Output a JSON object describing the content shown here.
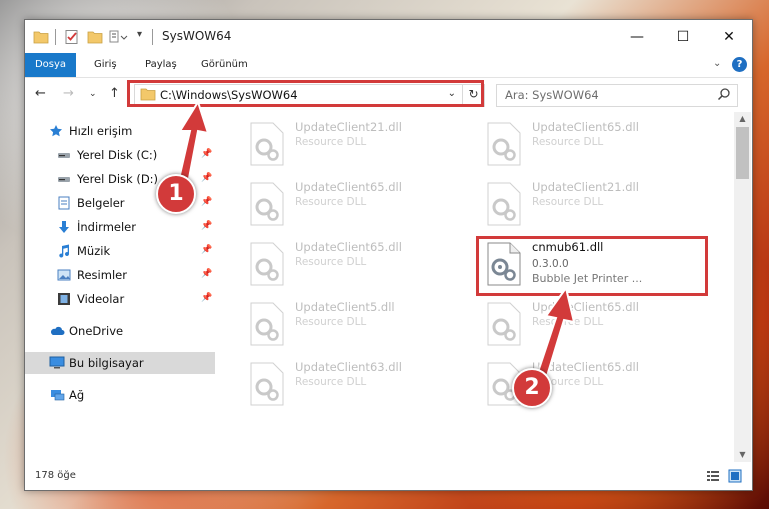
{
  "window": {
    "title": "SysWOW64"
  },
  "ribbon": {
    "tabs": [
      "Dosya",
      "Giriş",
      "Paylaş",
      "Görünüm"
    ]
  },
  "nav": {
    "address": "C:\\Windows\\SysWOW64",
    "search_placeholder": "Ara: SysWOW64"
  },
  "sidebar": {
    "items": [
      {
        "label": "Hızlı erişim"
      },
      {
        "label": "Yerel Disk (C:)"
      },
      {
        "label": "Yerel Disk (D:)"
      },
      {
        "label": "Belgeler"
      },
      {
        "label": "İndirmeler"
      },
      {
        "label": "Müzik"
      },
      {
        "label": "Resimler"
      },
      {
        "label": "Videolar"
      },
      {
        "label": "OneDrive"
      },
      {
        "label": "Bu bilgisayar"
      },
      {
        "label": "Ağ"
      }
    ]
  },
  "files": [
    {
      "name": "UpdateClient21.dll",
      "type": "Resource DLL"
    },
    {
      "name": "UpdateClient65.dll",
      "type": "Resource DLL"
    },
    {
      "name": "UpdateClient65.dll",
      "type": "Resource DLL"
    },
    {
      "name": "UpdateClient21.dll",
      "type": "Resource DLL"
    },
    {
      "name": "UpdateClient65.dll",
      "type": "Resource DLL"
    },
    {
      "name": "cnmub61.dll",
      "version": "0.3.0.0",
      "description": "Bubble Jet Printer ..."
    },
    {
      "name": "UpdateClient5.dll",
      "type": "Resource DLL"
    },
    {
      "name": "UpdateClient65.dll",
      "type": "Resource DLL"
    },
    {
      "name": "UpdateClient63.dll",
      "type": "Resource DLL"
    },
    {
      "name": "UpdateClient65.dll",
      "type": "Resource DLL"
    }
  ],
  "status": {
    "item_count": "178 öğe"
  },
  "badges": {
    "one": "1",
    "two": "2"
  },
  "colors": {
    "accent": "#1979ca",
    "highlight": "#d23a3a"
  }
}
